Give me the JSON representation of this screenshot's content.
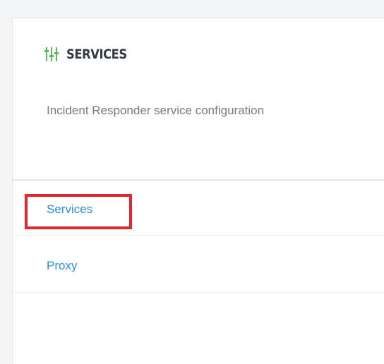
{
  "header": {
    "icon": "sliders-icon",
    "icon_color": "#5cb85c",
    "title": "SERVICES",
    "subtitle": "Incident Responder service configuration"
  },
  "nav": {
    "items": [
      {
        "label": "Services",
        "selected": true
      },
      {
        "label": "Proxy",
        "selected": false
      }
    ]
  },
  "colors": {
    "link": "#2b8fd6",
    "highlight": "#e3252c",
    "title": "#333a40",
    "subtitle": "#737a80"
  }
}
